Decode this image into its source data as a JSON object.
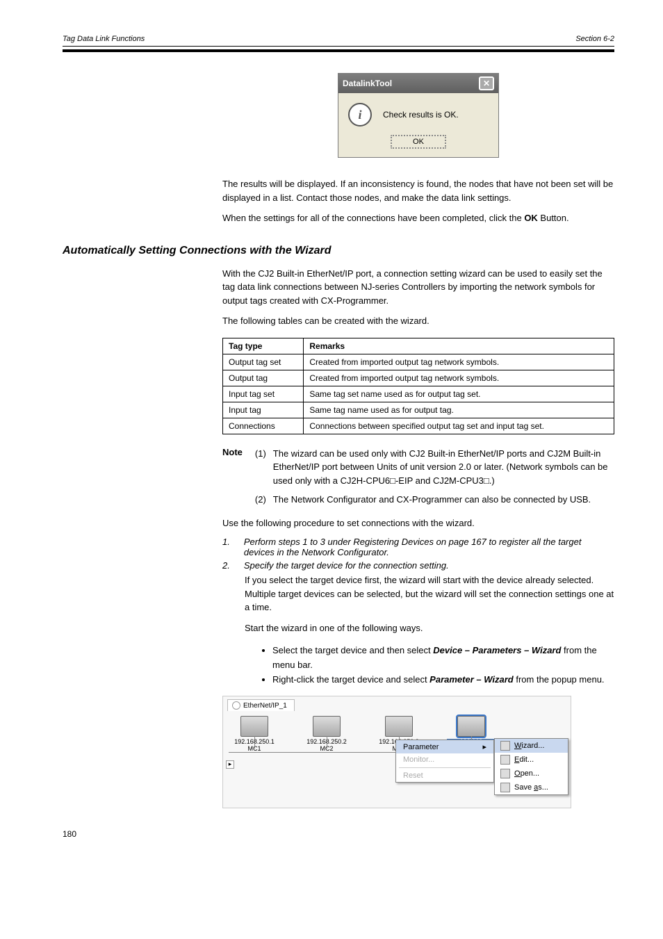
{
  "header": {
    "left": "Tag Data Link Functions",
    "right": "Section 6-2"
  },
  "dialog1": {
    "title": "DatalinkTool",
    "message": "Check results is OK.",
    "ok": "OK"
  },
  "para_after_dialog_1": "The results will be displayed. If an inconsistency is found, the nodes that have not been set will be displayed in a list. Contact those nodes, and make the data link settings.",
  "para_after_dialog_2": "When the settings for all of the connections have been completed, click the OK Button.",
  "section_title": "Automatically Setting Connections with the Wizard",
  "section_p1": "With the CJ2 Built-in EtherNet/IP port, a connection setting wizard can be used to easily set the tag data link connections between NJ-series Controllers by importing the network symbols for output tags created with CX-Programmer.",
  "section_p2": "The following tables can be created with the wizard.",
  "table": {
    "headers": [
      "Tag type",
      "Remarks"
    ],
    "rows": [
      [
        "Output tag set",
        "Created from imported output tag network symbols."
      ],
      [
        "Output tag",
        "Created from imported output tag network symbols."
      ],
      [
        "Input tag set",
        "Same tag set name used as for output tag set."
      ],
      [
        "Input tag",
        "Same tag name used as for output tag."
      ],
      [
        "Connections",
        "Connections between specified output tag set and input tag set."
      ]
    ]
  },
  "note_label": "Note",
  "notes": [
    "The wizard can be used only with CJ2 Built-in EtherNet/IP ports and CJ2M Built-in EtherNet/IP port between Units of unit version 2.0 or later. (Network symbols can be used only with a CJ2H-CPU6□-EIP and CJ2M-CPU3□.)",
    "The Network Configurator and CX-Programmer can also be connected by USB."
  ],
  "steps_intro": "Use the following procedure to set connections with the wizard.",
  "step1": {
    "n": "1.",
    "text": "Perform steps 1 to 3 under Registering Devices on page 167 to register all the target devices in the Network Configurator."
  },
  "step2_head": {
    "n": "2.",
    "text": "Specify the target device for the connection setting.",
    "p1": "If you select the target device first, the wizard will start with the device already selected. Multiple target devices can be selected, but the wizard will set the connection settings one at a time.",
    "p2": "Start the wizard in one of the following ways.",
    "bullets": [
      "Select the target device and then select Device – Parameters – Wizard from the menu bar.",
      "Right-click the target device and select Parameter – Wizard from the popup menu."
    ]
  },
  "netview": {
    "tab": "EtherNet/IP_1",
    "devices": [
      {
        "ip": "192.168.250.1",
        "name": "MC1"
      },
      {
        "ip": "192.168.250.2",
        "name": "MC2"
      },
      {
        "ip": "192.168.250.3",
        "name": "MC3"
      },
      {
        "ip": "192.168",
        "name": "MC"
      }
    ],
    "ctx": {
      "parameter": "Parameter",
      "monitor": "Monitor...",
      "reset": "Reset"
    },
    "submenu": {
      "wizard": "Wizard...",
      "edit": "Edit...",
      "open": "Open...",
      "saveas": "Save as..."
    }
  },
  "page_num": "180"
}
